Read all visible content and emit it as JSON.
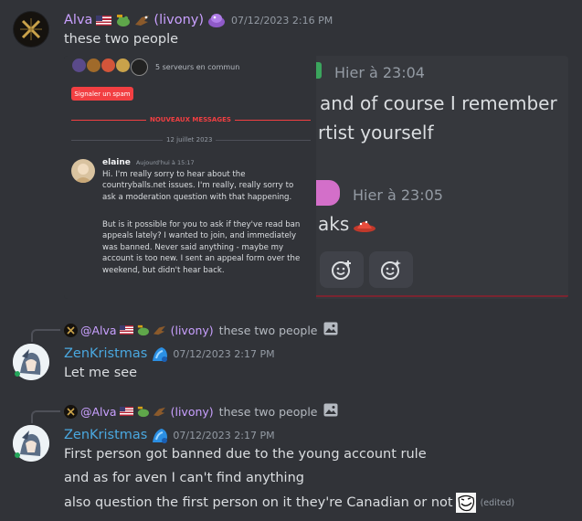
{
  "colors": {
    "background": "#313338",
    "alva_name": "#c9a0ff",
    "zen_name": "#4aa8e0",
    "timestamp": "#949ba4",
    "text": "#dbdee1",
    "spam_button": "#f23f42",
    "new_messages": "#f23f42"
  },
  "messages": [
    {
      "author": "Alva",
      "nick_suffix": "(livony)",
      "timestamp": "07/12/2023 2:16 PM",
      "lines": [
        "these two people"
      ],
      "avatar_icon": "gold-x-emblem-icon"
    },
    {
      "reply_author": "@Alva",
      "reply_suffix": "(livony)",
      "reply_text": "these two people",
      "author": "ZenKristmas",
      "timestamp": "07/12/2023 2:17 PM",
      "lines": [
        "Let me see"
      ],
      "avatar_icon": "anime-avatar-icon"
    },
    {
      "reply_author": "@Alva",
      "reply_suffix": "(livony)",
      "reply_text": "these two people",
      "author": "ZenKristmas",
      "timestamp": "07/12/2023 2:17 PM",
      "lines": [
        "First person got banned due to the young account rule",
        "and as for aven I can't find anything",
        "also question the first person on it they're Canadian or not"
      ],
      "edited": "(edited)",
      "avatar_icon": "anime-avatar-icon"
    }
  ],
  "screenshot": {
    "mutual_servers": "5 serveurs en commun",
    "spam_button": "Signaler un spam",
    "new_messages": "NOUVEAUX MESSAGES",
    "date_divider": "12 juillet 2023",
    "inner_author": "elaine",
    "inner_ts": "Aujourd'hui à 15:17",
    "inner_para1": "Hi. I'm really sorry to hear about the countryballs.net issues. I'm really, really sorry to ask a moderation question with that happening.",
    "inner_para2": "But is it possible for you to ask if they've read ban appeals lately? I wanted to join, and immediately was banned. Never said anything - maybe my account is too new. I sent an appeal form over the weekend, but didn't hear back.",
    "right_ts1": "Hier à 23:04",
    "right_line1": "and of course I remember",
    "right_line2": "rtist yourself",
    "right_ts2": "Hier à 23:05",
    "right_line3": "aks"
  }
}
